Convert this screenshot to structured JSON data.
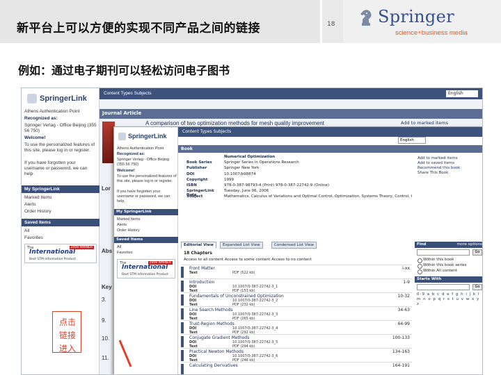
{
  "slide": {
    "title": "新平台上可以方便的实现不同产品之间的链接",
    "page_number": "18",
    "subtitle": "例如：通过电子期刊可以轻松访问电子图书",
    "logo": {
      "word": "Springer",
      "tagline": "science+business media"
    },
    "callout": "点击\n链接\n进入"
  },
  "back_page": {
    "logo": "SpringerLink",
    "tabs": "Content Types   Subjects",
    "language": "English",
    "band_label": "Journal Article",
    "article_title": "A comparison of two optimization methods for mesh quality improvement",
    "marked_items": "Add to marked items",
    "nav": {
      "auth": "Athens Authentication Point",
      "recognized": "Recognized as:",
      "org": "Springer Verlag - Office Beijing (355 56 750)",
      "welcome": "Welcome!",
      "welcome_text": "To use the personalized features of this site, please log in or register.",
      "forgot": "If you have forgotten your username or password, we can help.",
      "my_head": "My SpringerLink",
      "my_items": [
        "Marked Items",
        "Alerts",
        "Order History"
      ],
      "saved_head": "Saved Items",
      "saved_items": [
        "All",
        "Favorites"
      ]
    },
    "fragments": [
      "Lor",
      "Abs",
      "Key",
      "3.",
      "9.",
      "10.",
      "11."
    ]
  },
  "front_page": {
    "logo": "SpringerLink",
    "tabs": "Content Types   Subjects",
    "language": "English",
    "band_label": "Book",
    "nav": {
      "auth": "Athens Authentication Point",
      "recognized": "Recognized as:",
      "org": "Springer Verlag - Office Beijing (355 56 750)",
      "welcome": "Welcome!",
      "welcome_text": "To use the personalized features of this site, please log in or register.",
      "forgot": "If you have forgotten your username or password, we can help.",
      "my_head": "My SpringerLink",
      "my_items": [
        "Marked Items",
        "Alerts",
        "Order History"
      ],
      "saved_head": "Saved Items",
      "saved_items": [
        "All",
        "Favorites"
      ]
    },
    "ads": [
      {
        "the": "The",
        "big": "International",
        "tag": "2008 WINNER",
        "sub": "Best STM Information Product"
      },
      {
        "the": "The",
        "big": "International",
        "tag": "2008 WINNER",
        "sub": "Best STM Information Product"
      }
    ],
    "meta": [
      {
        "k": "",
        "v": "Numerical Optimization",
        "title": true
      },
      {
        "k": "Book Series",
        "v": "Springer Series in Operations Research"
      },
      {
        "k": "Publisher",
        "v": "Springer New York"
      },
      {
        "k": "DOI",
        "v": "10.1007/b98874"
      },
      {
        "k": "Copyright",
        "v": "1999"
      },
      {
        "k": "ISBN",
        "v": "978-0-387-98793-4 (Print) 978-0-387-22742-9 (Online)"
      },
      {
        "k": "SpringerLink Date",
        "v": "Tuesday, June 06, 2006"
      },
      {
        "k": "Subject",
        "v": "Mathematics, Calculus of Variations and Optimal Control, Optimization, Systems Theory, Control, Operations Research/Decision Theory and Mathematics and Statistics"
      }
    ],
    "actions": [
      "Add to marked items",
      "Add to saved items",
      "Recommend this book",
      "Share This Book"
    ],
    "view_tabs": [
      "Editorial View",
      "Expanded List View",
      "Condensed List View"
    ],
    "chapters_count": "18 Chapters",
    "filter": "Access to all content   Access to some content   Access to no content",
    "chapters": [
      {
        "title": "Front Matter",
        "pages": "i-xx",
        "doi_k": "Text",
        "doi_v": "PDF (522 kb)",
        "text_k": "",
        "text_v": ""
      },
      {
        "title": "Introduction",
        "pages": "1-9",
        "doi_k": "DOI",
        "doi_v": "10.1007/0-387-22742-3_1",
        "text_k": "Text",
        "text_v": "PDF (153 kb)"
      },
      {
        "title": "Fundamentals of Unconstrained Optimization",
        "pages": "10-32",
        "doi_k": "DOI",
        "doi_v": "10.1007/0-387-22742-3_2",
        "text_k": "Text",
        "text_v": "PDF (232 kb)"
      },
      {
        "title": "Line Search Methods",
        "pages": "34-63",
        "doi_k": "DOI",
        "doi_v": "10.1007/0-387-22742-3_3",
        "text_k": "Text",
        "text_v": "PDF (265 kb)"
      },
      {
        "title": "Trust-Region Methods",
        "pages": "64-99",
        "doi_k": "DOI",
        "doi_v": "10.1007/0-387-22742-3_4",
        "text_k": "Text",
        "text_v": "PDF (292 kb)"
      },
      {
        "title": "Conjugate Gradient Methods",
        "pages": "100-133",
        "doi_k": "DOI",
        "doi_v": "10.1007/0-387-22742-3_5",
        "text_k": "Text",
        "text_v": "PDF (294 kb)"
      },
      {
        "title": "Practical Newton Methods",
        "pages": "134-163",
        "doi_k": "DOI",
        "doi_v": "10.1007/0-387-22742-3_6",
        "text_k": "Text",
        "text_v": "PDF (246 kb)"
      },
      {
        "title": "Calculating Derivatives",
        "pages": "164-191",
        "doi_k": "",
        "doi_v": "",
        "text_k": "",
        "text_v": ""
      }
    ],
    "right": {
      "find_head": "Find",
      "more_options": "more options",
      "go": "Go",
      "find_options": [
        "Within this book",
        "Within this book series",
        "Within All content"
      ],
      "starts_head": "Starts With",
      "alpha": "0-9 a b c d e f g h i j k l m n o p q r s t u v w x y z"
    }
  },
  "colors": {
    "navy": "#3e527e",
    "accent": "#e0402a",
    "brand": "#36508f"
  }
}
